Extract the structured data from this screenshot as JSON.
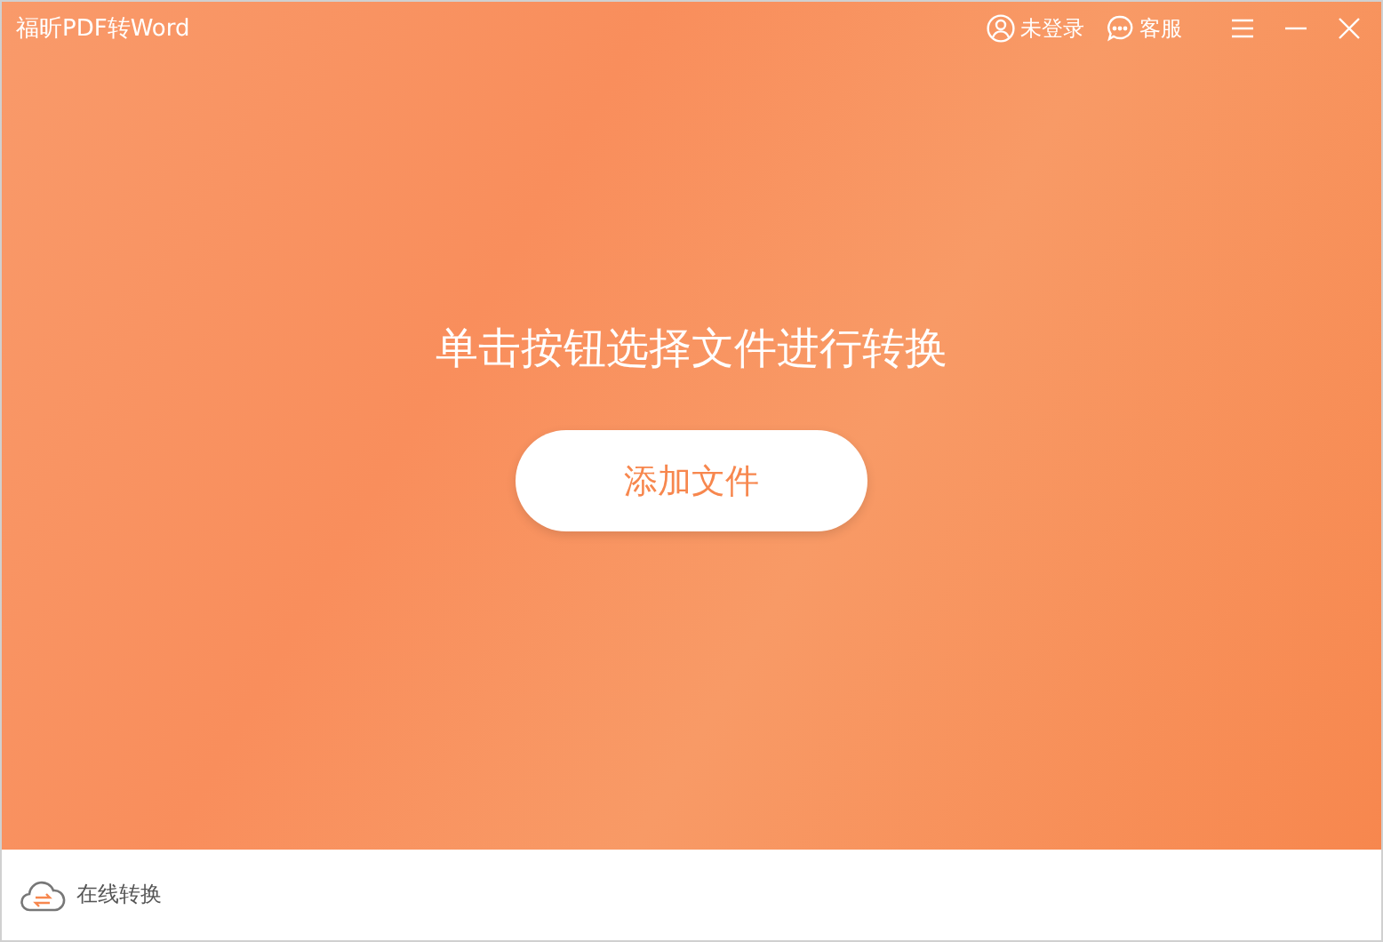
{
  "window": {
    "title": "福昕PDF转Word"
  },
  "header_actions": [
    {
      "kind": "user",
      "label": "未登录"
    },
    {
      "kind": "chat",
      "label": "客服"
    }
  ],
  "main": {
    "prompt": "单击按钮选择文件进行转换",
    "button": "添加文件"
  },
  "footer": {
    "link": "在线转换"
  }
}
